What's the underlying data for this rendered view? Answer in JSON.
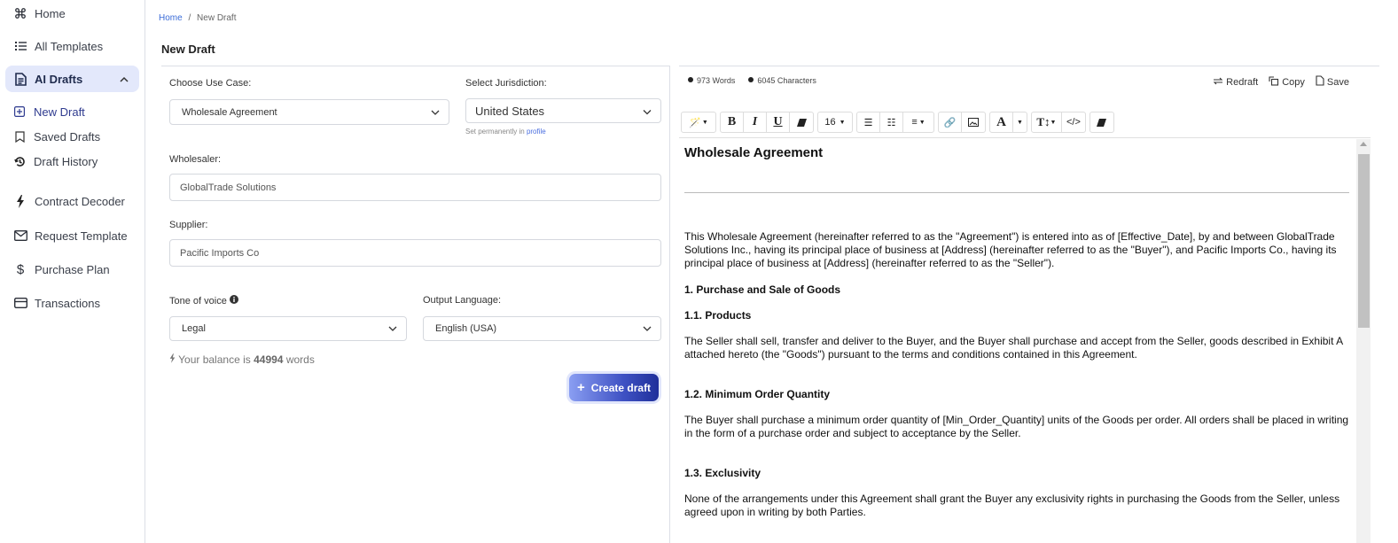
{
  "sidebar": {
    "items": [
      {
        "label": "Home",
        "icon": "command-icon"
      },
      {
        "label": "All Templates",
        "icon": "list-icon"
      },
      {
        "label": "AI Drafts",
        "icon": "document-icon",
        "active": true,
        "expanded": true
      },
      {
        "label": "Contract Decoder",
        "icon": "lightning-icon"
      },
      {
        "label": "Request Template",
        "icon": "mail-icon"
      },
      {
        "label": "Purchase Plan",
        "icon": "dollar-icon"
      },
      {
        "label": "Transactions",
        "icon": "card-icon"
      }
    ],
    "sub_items": [
      {
        "label": "New Draft",
        "icon": "plus-square-icon",
        "active": true
      },
      {
        "label": "Saved Drafts",
        "icon": "bookmark-icon"
      },
      {
        "label": "Draft History",
        "icon": "history-icon"
      }
    ]
  },
  "breadcrumb": {
    "home": "Home",
    "separator": "/",
    "current": "New Draft"
  },
  "page_title": "New Draft",
  "form": {
    "use_case_label": "Choose Use Case:",
    "use_case_value": "Wholesale Agreement",
    "jurisdiction_label": "Select Jurisdiction:",
    "jurisdiction_value": "United States",
    "jurisdiction_hint": "Set permanently in",
    "jurisdiction_hint_link": "profile",
    "wholesaler_label": "Wholesaler:",
    "wholesaler_value": "GlobalTrade Solutions",
    "supplier_label": "Supplier:",
    "supplier_value": "Pacific Imports Co",
    "tone_label": "Tone of voice",
    "tone_value": "Legal",
    "language_label": "Output Language:",
    "language_value": "English (USA)",
    "balance_prefix": "Your balance is",
    "balance_value": "44994",
    "balance_suffix": "words",
    "create_button": "Create draft"
  },
  "editor": {
    "words": "973 Words",
    "characters": "6045 Characters",
    "actions": {
      "redraft": "Redraft",
      "copy": "Copy",
      "save": "Save"
    },
    "toolbar": {
      "font_size": "16"
    },
    "document": {
      "title": "Wholesale Agreement",
      "intro": "This Wholesale Agreement (hereinafter referred to as the \"Agreement\") is entered into as of [Effective_Date], by and between GlobalTrade Solutions Inc., having its principal place of business at [Address] (hereinafter referred to as the \"Buyer\"), and Pacific Imports Co., having its principal place of business at [Address] (hereinafter referred to as the \"Seller\").",
      "section1": "1. Purchase and Sale of Goods",
      "s1_1_title": "1.1. Products",
      "s1_1_text": "The Seller shall sell, transfer and deliver to the Buyer, and the Buyer shall purchase and accept from the Seller, goods described in Exhibit A attached hereto (the \"Goods\") pursuant to the terms and conditions contained in this Agreement.",
      "s1_2_title": "1.2. Minimum Order Quantity",
      "s1_2_text": "The Buyer shall purchase a minimum order quantity of [Min_Order_Quantity] units of the Goods per order. All orders shall be placed in writing in the form of a purchase order and subject to acceptance by the Seller.",
      "s1_3_title": "1.3. Exclusivity",
      "s1_3_text": "None of the arrangements under this Agreement shall grant the Buyer any exclusivity rights in purchasing the Goods from the Seller, unless agreed upon in writing by both Parties."
    }
  }
}
